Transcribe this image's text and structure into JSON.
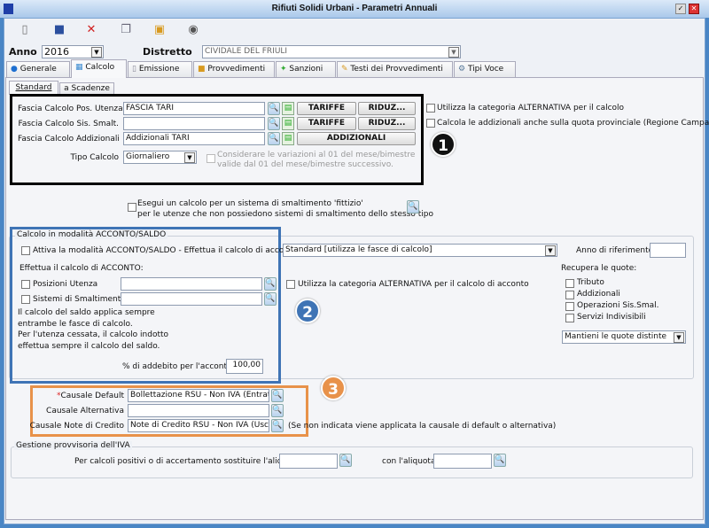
{
  "window": {
    "title": "Rifiuti Solidi Urbani - Parametri Annuali"
  },
  "toolbar": [
    {
      "icon": "new-icon"
    },
    {
      "icon": "save-icon"
    },
    {
      "icon": "delete-icon"
    },
    {
      "icon": "copy-icon"
    },
    {
      "icon": "paste-icon"
    },
    {
      "icon": "camera-icon"
    }
  ],
  "header": {
    "anno_label": "Anno",
    "anno_value": "2016",
    "distretto_label": "Distretto",
    "distretto_value": "CIVIDALE DEL FRIULI"
  },
  "tabs": [
    "Generale",
    "Calcolo",
    "Emissione",
    "Provvedimenti",
    "Sanzioni",
    "Testi dei Provvedimenti",
    "Tipi Voce"
  ],
  "subtabs": [
    "Standard",
    "a Scadenze"
  ],
  "fasce": {
    "rows": [
      {
        "label": "Fascia Calcolo Pos. Utenza",
        "value": "FASCIA TARI"
      },
      {
        "label": "Fascia Calcolo Sis. Smalt.",
        "value": ""
      },
      {
        "label": "Fascia Calcolo Addizionali",
        "value": "Addizionali TARI"
      }
    ],
    "tariffe": "TARIFFE",
    "riduz": "RIDUZ...",
    "addizionali": "ADDIZIONALI",
    "tipo_label": "Tipo Calcolo",
    "tipo_value": "Giornaliero",
    "variazioni_1": "Considerare le variazioni al 01 del mese/bimestre",
    "variazioni_2": "valide dal 01 del mese/bimestre successivo."
  },
  "right_opts": [
    "Utilizza la categoria ALTERNATIVA per il calcolo",
    "Calcola le addizionali anche sulla quota provinciale (Regione Campania)"
  ],
  "fittizio": [
    "Esegui un calcolo per un sistema di smaltimento 'fittizio'",
    "per le utenze che non possiedono sistemi di smaltimento dello stesso tipo"
  ],
  "acconto": {
    "legend": "Calcolo in modalità ACCONTO/SALDO",
    "attiva": "Attiva la modalità ACCONTO/SALDO - Effettua il calcolo di acconto:",
    "modo": "Standard [utilizza le fasce di calcolo]",
    "anno_rif": "Anno di riferimento",
    "effettua": "Effettua il calcolo di ACCONTO:",
    "posizioni": "Posizioni Utenza",
    "sistemi": "Sistemi di Smaltimento",
    "note": [
      "Il calcolo del saldo applica sempre",
      "entrambe le fasce di calcolo.",
      "Per l'utenza cessata, il calcolo indotto",
      "effettua sempre il calcolo del saldo."
    ],
    "perc_label": "% di addebito per l'acconto",
    "perc_value": "100,00",
    "alt": "Utilizza la categoria ALTERNATIVA per il calcolo di acconto",
    "recupera": "Recupera le quote:",
    "quote": [
      "Tributo",
      "Addizionali",
      "Operazioni Sis.Smal.",
      "Servizi Indivisibili"
    ],
    "mantieni": "Mantieni le quote distinte"
  },
  "causali": {
    "default_label": "Causale Default",
    "default_value": "Bollettazione RSU - Non IVA (Entrata)",
    "alt_label": "Causale Alternativa",
    "alt_value": "",
    "nc_label": "Causale Note di Credito",
    "nc_value": "Note di Credito RSU - Non IVA (Uscita)",
    "nc_hint": "(Se non indicata viene applicata la causale di default o alternativa)",
    "required": "*"
  },
  "iva": {
    "legend": "Gestione provvisoria dell'IVA",
    "label1": "Per calcoli positivi o di accertamento sostituire l'aliquota",
    "label2": "con l'aliquota"
  },
  "callouts": [
    "1",
    "2",
    "3"
  ],
  "colors": {
    "black_box": "#000000",
    "blue_box": "#3f74b5",
    "orange_box": "#e8924a"
  }
}
